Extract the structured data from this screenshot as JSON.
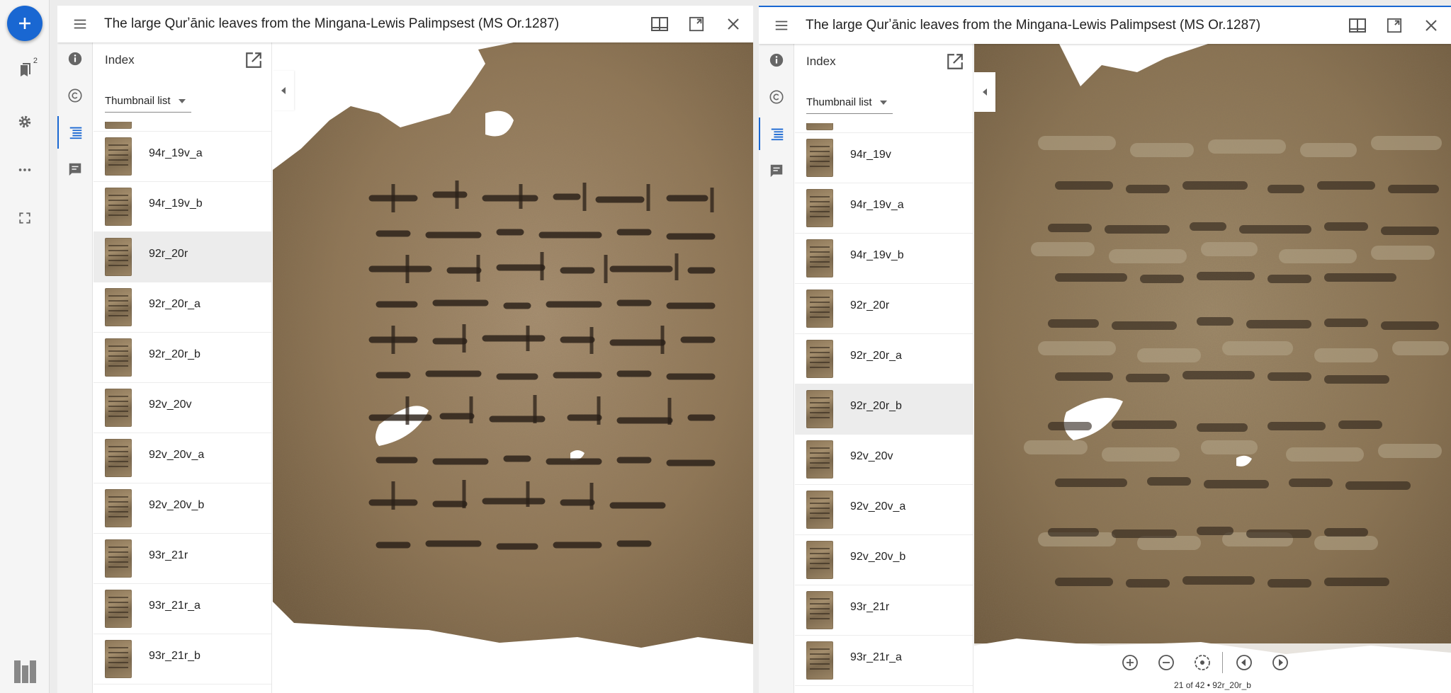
{
  "workspace": {
    "add_label": "+",
    "bookmark_count": "2"
  },
  "windows": [
    {
      "title": "The large Qurʼānic leaves from the Mingana-Lewis Palimpsest (MS Or.1287)",
      "panel_title": "Index",
      "select_value": "Thumbnail list",
      "items": [
        "94r_19v_a",
        "94r_19v_b",
        "92r_20r",
        "92r_20r_a",
        "92r_20r_b",
        "92v_20v",
        "92v_20v_a",
        "92v_20v_b",
        "93r_21r",
        "93r_21r_a",
        "93r_21r_b"
      ],
      "selected_index": 2
    },
    {
      "title": "The large Qurʼānic leaves from the Mingana-Lewis Palimpsest (MS Or.1287)",
      "panel_title": "Index",
      "select_value": "Thumbnail list",
      "items": [
        "94r_19v",
        "94r_19v_a",
        "94r_19v_b",
        "92r_20r",
        "92r_20r_a",
        "92r_20r_b",
        "92v_20v",
        "92v_20v_a",
        "92v_20v_b",
        "93r_21r",
        "93r_21r_a"
      ],
      "selected_index": 5,
      "canvas_info": "21 of 42 • 92r_20r_b"
    }
  ],
  "colors": {
    "accent": "#1967d2",
    "parchment": "#8c7658"
  }
}
